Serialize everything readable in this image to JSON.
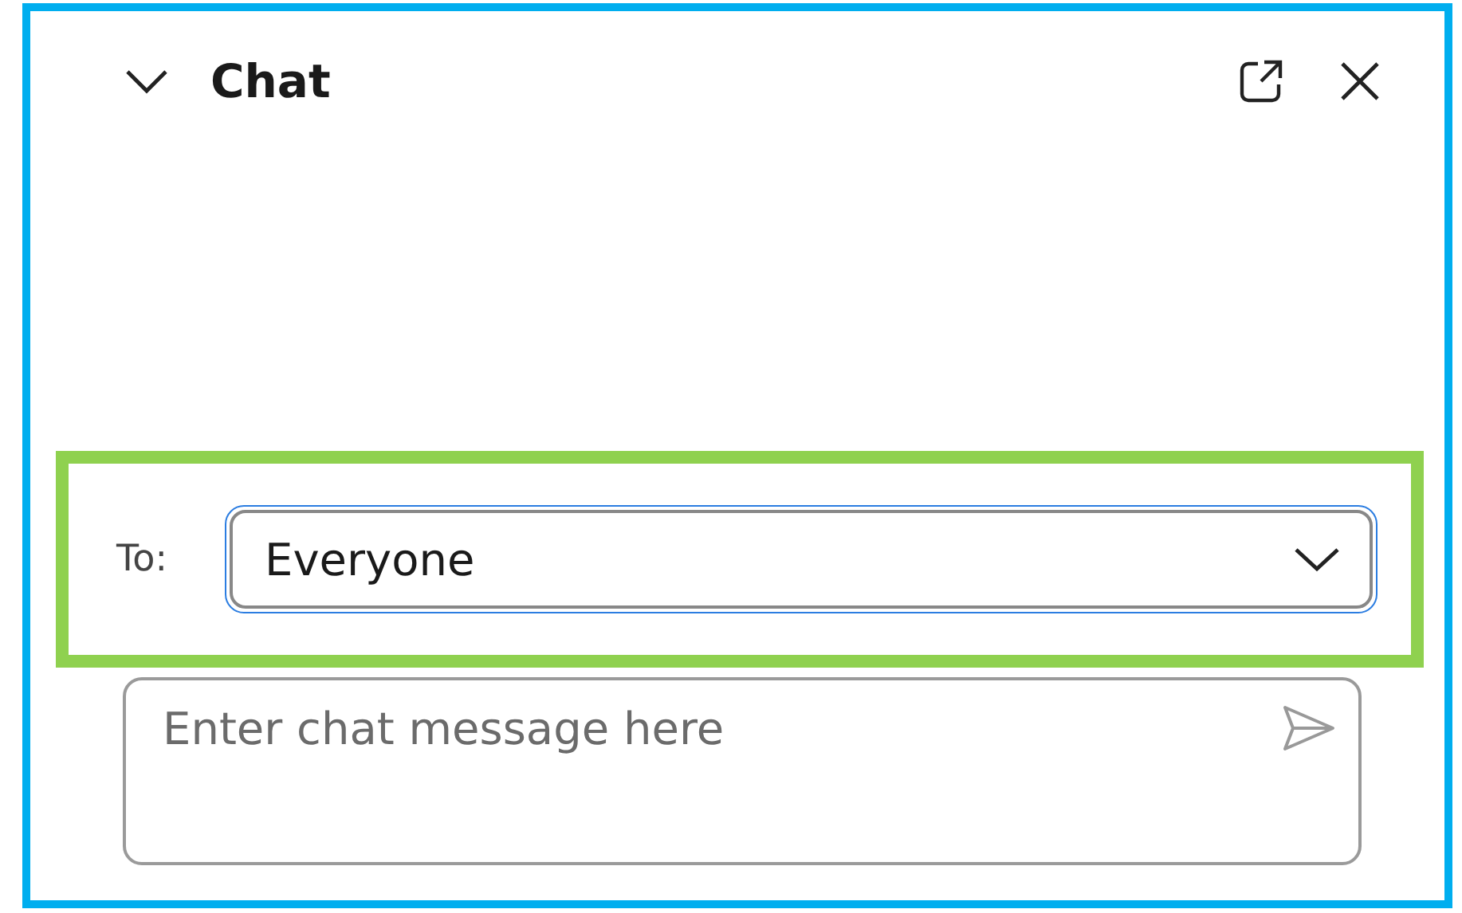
{
  "panel": {
    "title": "Chat",
    "expanded": true
  },
  "recipient": {
    "label": "To:",
    "value": "Everyone",
    "focused": true,
    "highlighted": true
  },
  "message": {
    "placeholder": "Enter chat message here"
  }
}
